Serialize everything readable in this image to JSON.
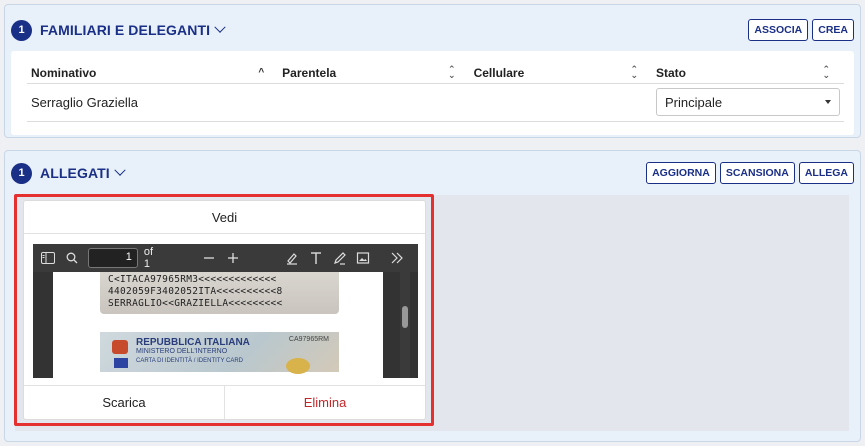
{
  "familiari": {
    "count": "1",
    "title": "FAMILIARI E DELEGANTI",
    "buttons": {
      "associa": "ASSOCIA",
      "crea": "CREA"
    },
    "columns": [
      "Nominativo",
      "Parentela",
      "Cellulare",
      "Stato"
    ],
    "rows": [
      {
        "nominativo": "Serraglio Graziella",
        "parentela": "",
        "cellulare": "",
        "stato": "Principale"
      }
    ]
  },
  "allegati": {
    "count": "1",
    "title": "ALLEGATI",
    "buttons": {
      "aggiorna": "AGGIORNA",
      "scansiona": "SCANSIONA",
      "allega": "ALLEGA"
    },
    "document": {
      "view_label": "Vedi",
      "viewer": {
        "page": "1",
        "of_label": "of 1"
      },
      "mrz_lines": [
        "C<ITACA97965RM3<<<<<<<<<<<<<",
        "4402059F3402052ITA<<<<<<<<<<8",
        "SERRAGLIO<<GRAZIELLA<<<<<<<<<"
      ],
      "card": {
        "line1": "REPUBBLICA ITALIANA",
        "line2": "MINISTERO DELL'INTERNO",
        "line3": "CARTA DI IDENTITÀ / IDENTITY CARD",
        "number": "CA97965RM"
      },
      "download_label": "Scarica",
      "delete_label": "Elimina"
    }
  },
  "colors": {
    "accent": "#1a2f86",
    "danger": "#c0282a",
    "highlight": "#e53030"
  }
}
